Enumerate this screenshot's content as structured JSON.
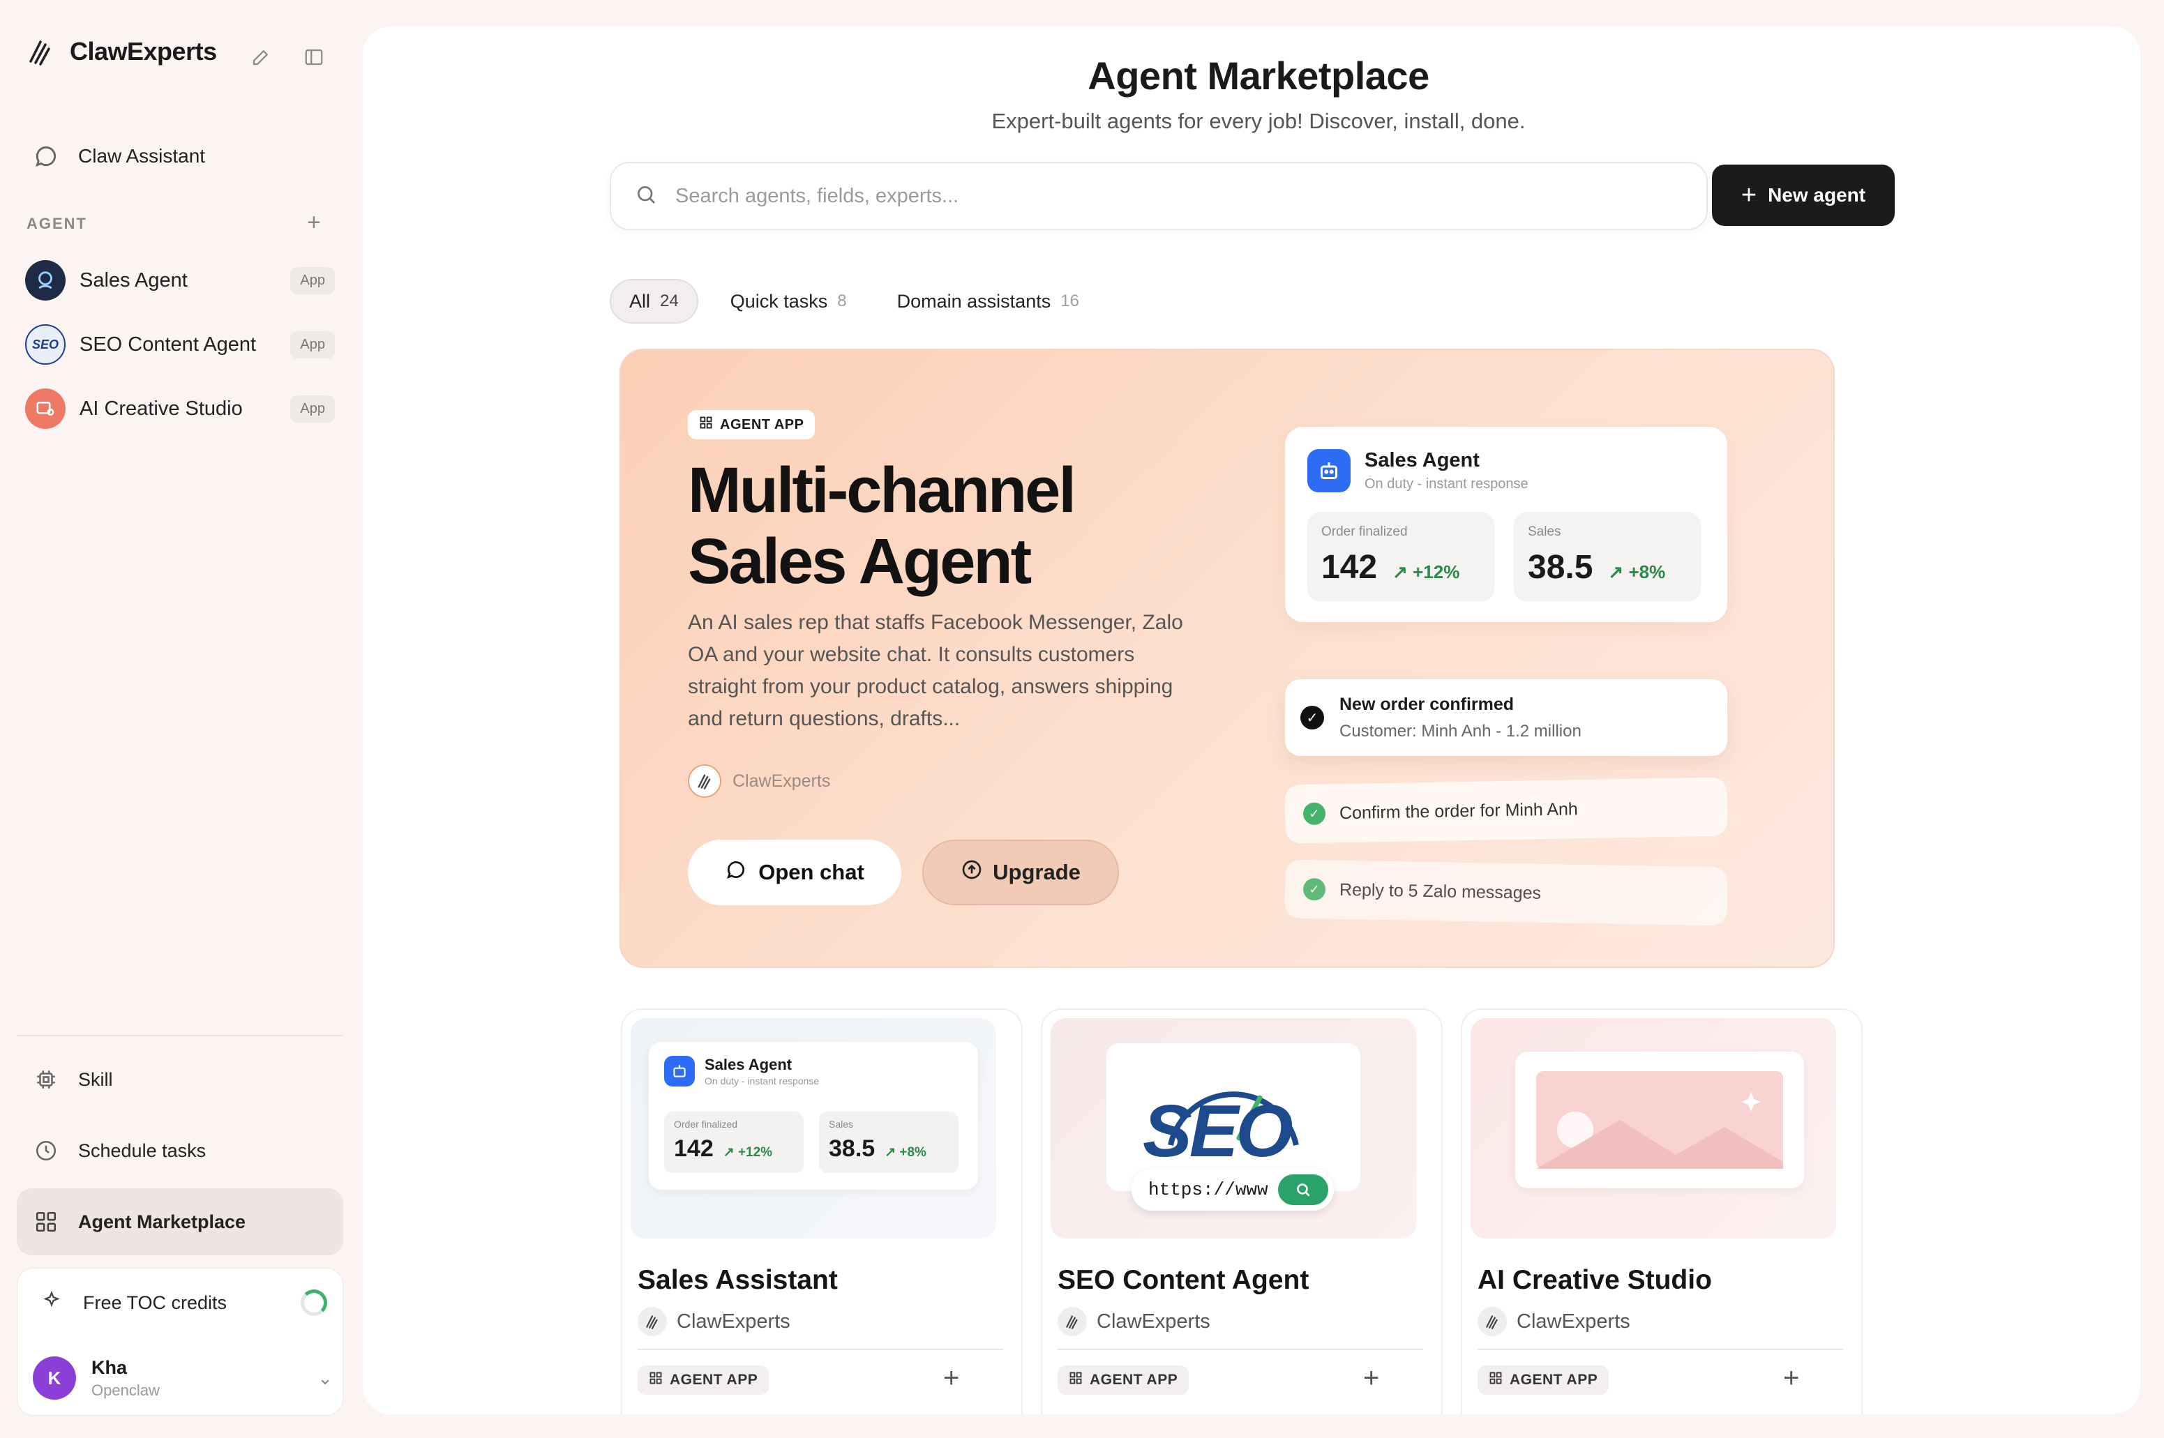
{
  "brand": {
    "name": "ClawExperts"
  },
  "sidebar": {
    "assistant_label": "Claw Assistant",
    "section_label": "AGENT",
    "agents": [
      {
        "label": "Sales Agent",
        "badge": "App"
      },
      {
        "label": "SEO Content Agent",
        "badge": "App"
      },
      {
        "label": "AI Creative Studio",
        "badge": "App"
      }
    ],
    "nav": [
      {
        "label": "Skill",
        "icon": "chip-icon"
      },
      {
        "label": "Schedule tasks",
        "icon": "clock-icon"
      },
      {
        "label": "Agent Marketplace",
        "icon": "grid-icon",
        "active": true
      }
    ],
    "credits_label": "Free TOC credits",
    "user": {
      "initial": "K",
      "name": "Kha",
      "org": "Openclaw"
    }
  },
  "page": {
    "title": "Agent Marketplace",
    "subtitle": "Expert-built agents for every job! Discover, install, done."
  },
  "search": {
    "placeholder": "Search agents, fields, experts..."
  },
  "new_agent_label": "New agent",
  "tabs": [
    {
      "label": "All",
      "count": "24",
      "active": true
    },
    {
      "label": "Quick tasks",
      "count": "8"
    },
    {
      "label": "Domain assistants",
      "count": "16"
    }
  ],
  "hero": {
    "badge": "AGENT APP",
    "title_line1": "Multi-channel",
    "title_line2": "Sales Agent",
    "description": "An AI sales rep that staffs Facebook Messenger, Zalo OA and your website chat. It consults customers straight from your product catalog, answers shipping and return questions, drafts...",
    "author": "ClawExperts",
    "open_chat_label": "Open chat",
    "upgrade_label": "Upgrade",
    "card": {
      "name": "Sales Agent",
      "status": "On duty - instant response",
      "stats": [
        {
          "label": "Order finalized",
          "value": "142",
          "delta": "+12%"
        },
        {
          "label": "Sales",
          "value": "38.5",
          "delta": "+8%"
        }
      ]
    },
    "notice": {
      "title": "New order confirmed",
      "subtitle": "Customer: Minh Anh - 1.2 million"
    },
    "tasks": [
      "Confirm the order for Minh Anh",
      "Reply to 5 Zalo messages"
    ]
  },
  "cards": [
    {
      "title": "Sales Assistant",
      "author": "ClawExperts",
      "badge": "AGENT APP",
      "thumb": {
        "name": "Sales Agent",
        "status": "On duty - instant response",
        "stats": [
          {
            "label": "Order finalized",
            "value": "142",
            "delta": "+12%"
          },
          {
            "label": "Sales",
            "value": "38.5",
            "delta": "+8%"
          }
        ]
      }
    },
    {
      "title": "SEO Content Agent",
      "author": "ClawExperts",
      "badge": "AGENT APP",
      "thumb": {
        "logo_text": "SEO",
        "url_text": "https://www"
      }
    },
    {
      "title": "AI Creative Studio",
      "author": "ClawExperts",
      "badge": "AGENT APP"
    }
  ],
  "colors": {
    "accent_dark": "#1b1b1b",
    "hero_bg": "#fbcfb6",
    "positive": "#2a8a4a",
    "bot_blue": "#2d6df6"
  }
}
